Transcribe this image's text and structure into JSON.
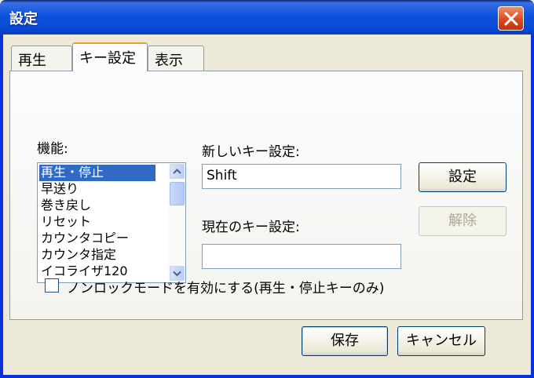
{
  "window": {
    "title": "設定"
  },
  "tabs": [
    {
      "label": "再生"
    },
    {
      "label": "キー設定"
    },
    {
      "label": "表示"
    }
  ],
  "function_label": "機能:",
  "functions": [
    "再生・停止",
    "早送り",
    "巻き戻し",
    "リセット",
    "カウンタコピー",
    "カウンタ指定",
    "イコライザ120"
  ],
  "new_key": {
    "label": "新しいキー設定:",
    "value": "Shift"
  },
  "current_key": {
    "label": "現在のキー設定:",
    "value": ""
  },
  "buttons": {
    "set": "設定",
    "release": "解除",
    "save": "保存",
    "cancel": "キャンセル"
  },
  "nonlock": {
    "label": "ノンロックモードを有効にする(再生・停止キーのみ)",
    "checked": false
  },
  "colors": {
    "selection": "#316ac5",
    "titlebar": "#0a49d6",
    "close": "#d8461c"
  }
}
